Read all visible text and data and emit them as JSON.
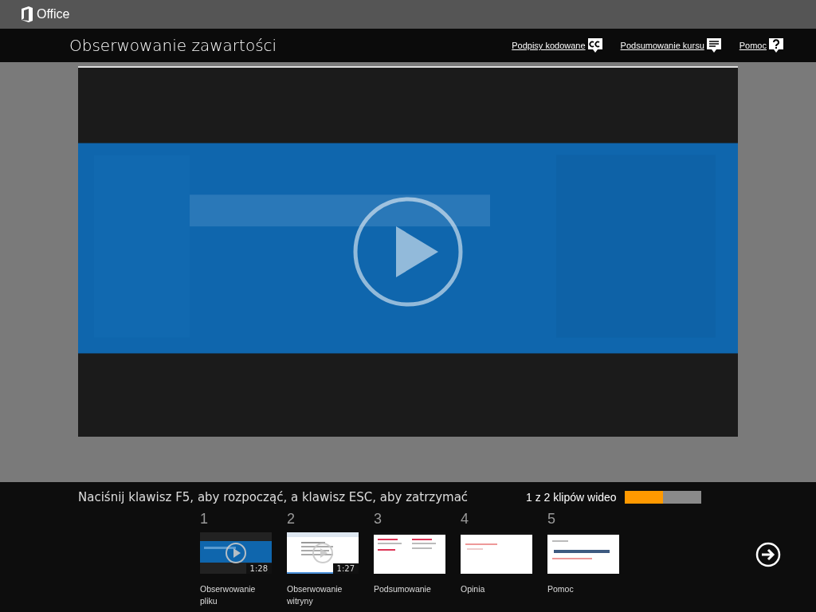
{
  "app_bar": {
    "brand": "Office"
  },
  "header": {
    "title": "Obserwowanie zawartości",
    "links": [
      {
        "label": "Podpisy kodowane"
      },
      {
        "label": "Podsumowanie kursu"
      },
      {
        "label": "Pomoc"
      }
    ]
  },
  "footer": {
    "hint": "Naciśnij klawisz F5, aby rozpocząć, a klawisz ESC, aby zatrzymać",
    "progress_label": "1 z 2 klipów wideo",
    "progress": {
      "level": 0.5
    },
    "clips": [
      {
        "number": "1",
        "title": "Obserwowanie pliku",
        "kind": "video",
        "duration": "1:28"
      },
      {
        "number": "2",
        "title": "Obserwowanie witryny",
        "kind": "video",
        "duration": "1:27"
      },
      {
        "number": "3",
        "title": "Podsumowanie",
        "kind": "page"
      },
      {
        "number": "4",
        "title": "Opinia",
        "kind": "page"
      },
      {
        "number": "5",
        "title": "Pomoc",
        "kind": "page"
      }
    ]
  }
}
